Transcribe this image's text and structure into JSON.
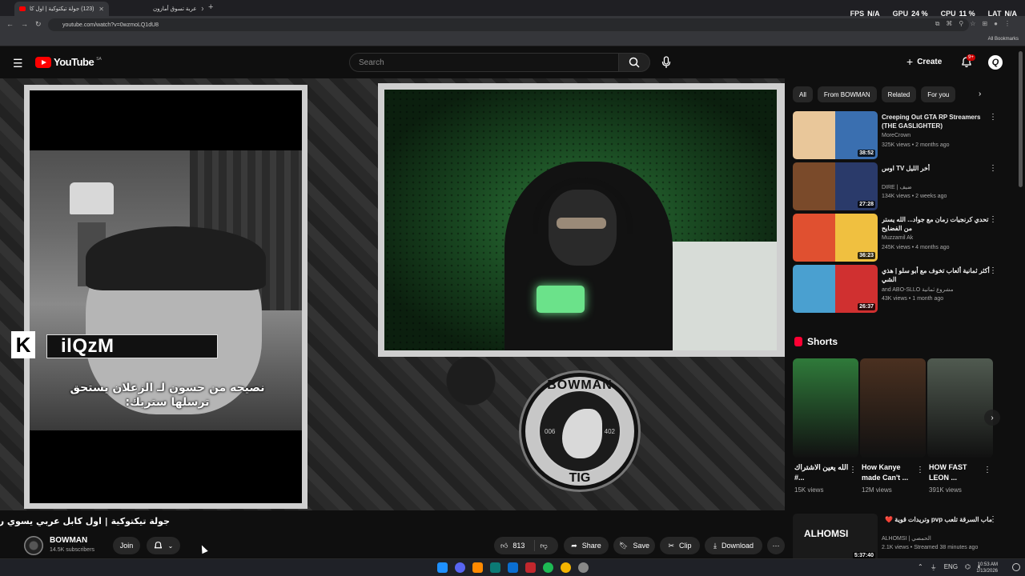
{
  "browser": {
    "tabs": [
      {
        "title": "(123) جولة تيكتوكية | اول كا",
        "active": true
      },
      {
        "title": "عربة تسوق أمازون",
        "active": false
      }
    ],
    "overlay": {
      "fps_label": "FPS",
      "fps": "N/A",
      "gpu_label": "GPU",
      "gpu": "24 %",
      "cpu_label": "CPU",
      "cpu": "11 %",
      "lat_label": "LAT",
      "lat": "N/A"
    },
    "url": "youtube.com/watch?v=0wzmoLQ1dU8",
    "all_bookmarks": "All Bookmarks"
  },
  "youtube": {
    "logo_text": "YouTube",
    "region": "SA",
    "search_placeholder": "Search",
    "create_label": "Create",
    "notif_badge": "9+",
    "avatar_letter": "Q"
  },
  "video": {
    "name_overlay": "ilQzM",
    "caption_line1": "نصيحه من حسون لـ الزعلان يستحق",
    "caption_line2": "ترسلها ستريك:",
    "emblem_top": "BOWMAN",
    "emblem_bottom": "TIG",
    "emblem_left": "006",
    "emblem_right": "402",
    "title": "جولة تيكتوكية | اول كابل عربي يسوي راب !!",
    "channel": "BOWMAN",
    "subscribers": "14.5K subscribers",
    "join_label": "Join",
    "likes": "813",
    "share_label": "Share",
    "save_label": "Save",
    "clip_label": "Clip",
    "download_label": "Download"
  },
  "sidebar": {
    "chips": [
      "All",
      "From BOWMAN",
      "Related",
      "For you"
    ],
    "recommendations": [
      {
        "title": "Creeping Out GTA RP Streamers (THE GASLIGHTER)",
        "channel": "MoreCrown",
        "meta": "325K views • 2 months ago",
        "duration": "38:52",
        "thumb_colors": [
          "#e9c79a",
          "#3a6fb0"
        ]
      },
      {
        "title": "اوس TV أخر الليل",
        "channel": "DIRE | ضيف",
        "meta": "134K views • 2 weeks ago",
        "duration": "27:28",
        "thumb_colors": [
          "#7a4a2a",
          "#2a3a6a"
        ]
      },
      {
        "title": "تحدي كرنجيات زمان مع جواد... الله يستر من الفضايح",
        "channel": "Muzzamil Ak",
        "meta": "245K views • 4 months ago",
        "duration": "36:23",
        "thumb_colors": [
          "#e05030",
          "#f0c040"
        ]
      },
      {
        "title": "أكثر ثمانية ألعاب تخوف مع أبو سلو | هذي الشي",
        "channel": "and ABO-SLLO مشروع ثمانية",
        "meta": "43K views • 1 month ago",
        "duration": "26:37",
        "thumb_colors": [
          "#4aa0d0",
          "#d03030"
        ]
      }
    ],
    "shorts_label": "Shorts",
    "shorts": [
      {
        "title": "الله يعين الاشتراك #...",
        "views": "15K views",
        "color": "#2f7a3a"
      },
      {
        "title": "How Kanye made Can't ...",
        "views": "12M views",
        "color": "#4a3020"
      },
      {
        "title": "HOW FAST LEON ...",
        "views": "391K views",
        "color": "#505a50"
      }
    ],
    "live": {
      "title": "ماب السرقة تلعب pvp وتريدات قوية ❤️",
      "thumb_text": "ALHOMSI",
      "channel": "ALHOMSI | الحمصي",
      "meta": "2.1K views • Streamed 38 minutes ago",
      "duration": "5:37:40"
    }
  },
  "taskbar": {
    "lang": "ENG",
    "time": "10:53 AM",
    "date": "1/13/2026"
  }
}
